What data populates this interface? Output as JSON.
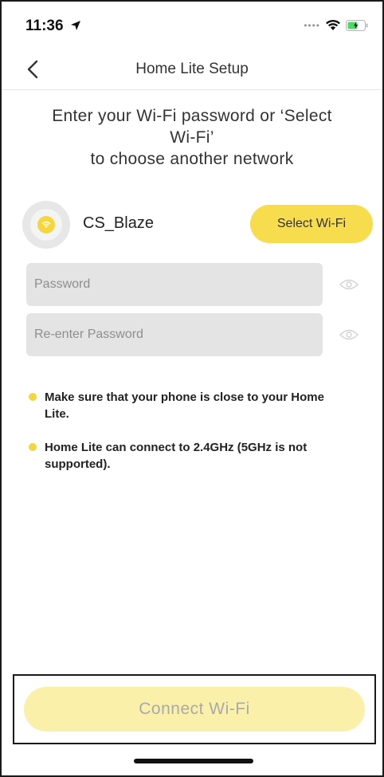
{
  "status_bar": {
    "time": "11:36",
    "icons": [
      "location-arrow-icon",
      "signal-dots-icon",
      "wifi-icon",
      "battery-icon"
    ]
  },
  "nav": {
    "title": "Home Lite Setup",
    "back_icon": "chevron-left-icon"
  },
  "instruction": {
    "line1": "Enter your Wi-Fi password or ‘Select",
    "line2": "Wi-Fi’",
    "line3": "to choose another network"
  },
  "network": {
    "name": "CS_Blaze",
    "icon": "wifi-badge-icon",
    "select_button_label": "Select Wi-Fi"
  },
  "fields": {
    "password": {
      "placeholder": "Password",
      "value": ""
    },
    "reenter_password": {
      "placeholder": "Re-enter Password",
      "value": ""
    },
    "toggle_icon": "eye-icon"
  },
  "tips": [
    {
      "text": "Make sure that your phone is close to your Home Lite."
    },
    {
      "text": "Home Lite can connect to 2.4GHz (5GHz is not supported)."
    }
  ],
  "connect": {
    "label": "Connect Wi-Fi"
  },
  "colors": {
    "accent": "#f7dd4e",
    "accent_disabled": "#fbf0aa",
    "field_bg": "#e4e4e4"
  }
}
